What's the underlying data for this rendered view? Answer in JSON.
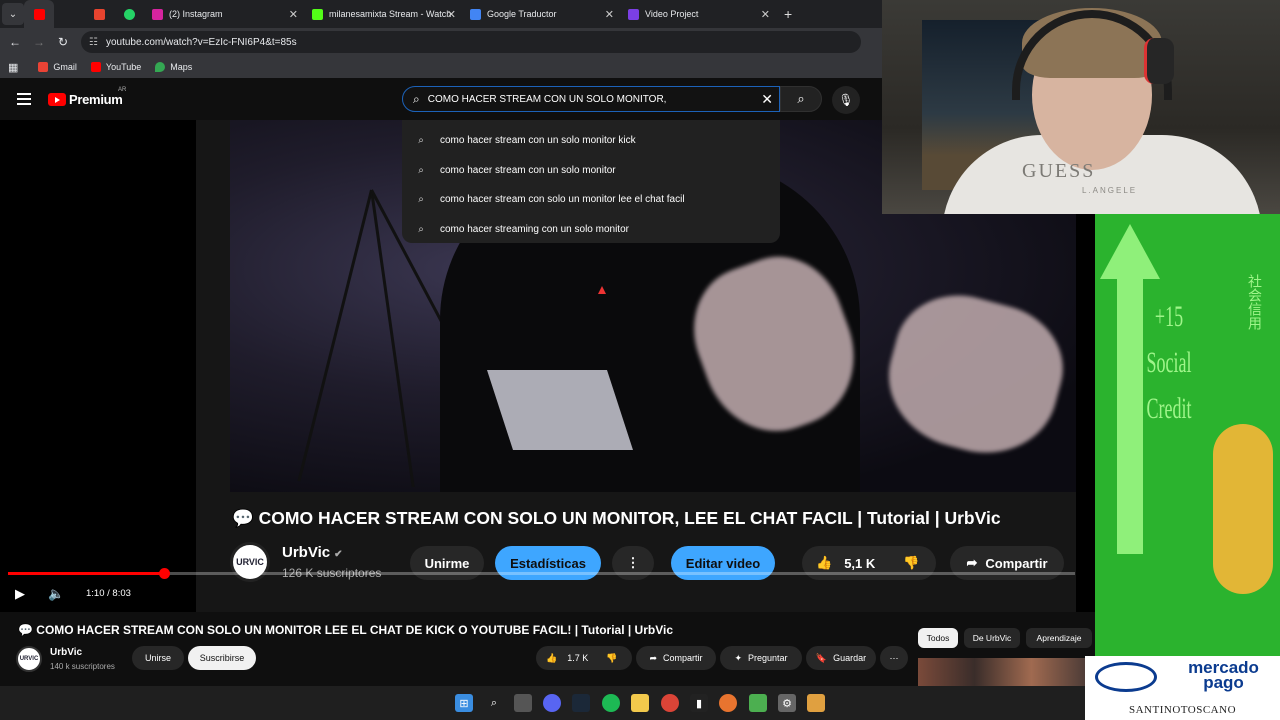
{
  "browser": {
    "tabs": [
      {
        "label": "",
        "color": "#ff0000"
      },
      {
        "label": "",
        "color": "#e8442f"
      },
      {
        "label": "",
        "color": "#25d366"
      },
      {
        "label": "(2) Instagram",
        "color": "#d6249f"
      },
      {
        "label": "milanesamixta Stream - Watch",
        "color": "#53fc18"
      },
      {
        "label": "Google Traductor",
        "color": "#4285f4"
      },
      {
        "label": "Video Project",
        "color": "#7b3fe4"
      }
    ],
    "url": "youtube.com/watch?v=EzIc-FNI6P4&t=85s",
    "bookmarks": [
      {
        "label": "Gmail",
        "color": "#ea4335"
      },
      {
        "label": "YouTube",
        "color": "#ff0000"
      },
      {
        "label": "Maps",
        "color": "#34a853"
      }
    ]
  },
  "youtube": {
    "logo_word": "Premium",
    "country_code": "AR",
    "search_query": "COMO HACER STREAM CON UN SOLO MONITOR,",
    "suggestions": [
      "como hacer stream con un solo monitor kick",
      "como hacer stream con un solo monitor",
      "como hacer stream con solo un monitor lee el chat facil",
      "como hacer streaming con un solo monitor"
    ]
  },
  "player": {
    "overlay_title": "💬 COMO HACER STREAM CON SOLO UN MONITOR, LEE EL CHAT FACIL | Tutorial | UrbVic",
    "overlay_channel": "UrbVic",
    "overlay_subs": "126 K suscriptores",
    "overlay_buttons": {
      "join": "Unirme",
      "stats": "Estadísticas",
      "edit": "Editar video",
      "likes": "5,1 K",
      "share": "Compartir"
    },
    "time": "1:10 / 8:03",
    "progress": 0.146
  },
  "video_meta": {
    "title": "💬 COMO HACER STREAM CON SOLO UN MONITOR LEE EL CHAT DE KICK O YOUTUBE FACIL! | Tutorial | UrbVic",
    "channel": "UrbVic",
    "subs": "140 k suscriptores",
    "join": "Unirse",
    "subscribe": "Suscribirse",
    "likes": "1.7 K",
    "share": "Compartir",
    "ask": "Preguntar",
    "save": "Guardar",
    "chips": [
      "Todos",
      "De UrbVic",
      "Aprendizaje"
    ]
  },
  "webcam": {
    "shirt_brand": "GUESS",
    "shirt_sub": "L.ANGELE"
  },
  "ads": {
    "credit_lines": [
      "+15",
      "Social",
      "Credit"
    ],
    "credit_side": "社会信用",
    "mp_text": "mercado pago",
    "mp_name": "SANTINOTOSCANO"
  }
}
